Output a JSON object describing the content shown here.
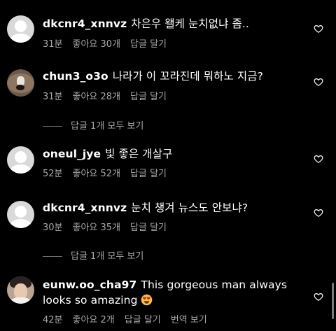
{
  "comments": [
    {
      "user": "dkcnr4_xnnvz",
      "text": "차은우 왤케 눈치없냐 좀..",
      "time": "31분",
      "likes": "좋아요 30개",
      "reply": "답글 달기"
    },
    {
      "user": "chun3_o3o",
      "text": "나라가 이 꼬라진데 뭐하노 지금?",
      "time": "31분",
      "likes": "좋아요 28개",
      "reply": "답글 달기",
      "more_replies": "답글 1개 모두 보기"
    },
    {
      "user": "oneul_jye",
      "text": "빛 좋은 개살구",
      "time": "52분",
      "likes": "좋아요 52개",
      "reply": "답글 달기"
    },
    {
      "user": "dkcnr4_xnnvz",
      "text": "눈치 챙겨 뉴스도 안보냐?",
      "time": "30분",
      "likes": "좋아요 35개",
      "reply": "답글 달기",
      "more_replies": "답글 1개 모두 보기"
    },
    {
      "user": "eunw.oo_cha97",
      "text": "This gorgeous man always looks so amazing",
      "time": "42분",
      "likes": "좋아요 2개",
      "reply": "답글 달기",
      "translate": "번역 보기"
    }
  ],
  "icons": {
    "like": "heart-outline-icon",
    "emoji": "heart-eyes-emoji",
    "avatar_default": "default-user-avatar"
  }
}
